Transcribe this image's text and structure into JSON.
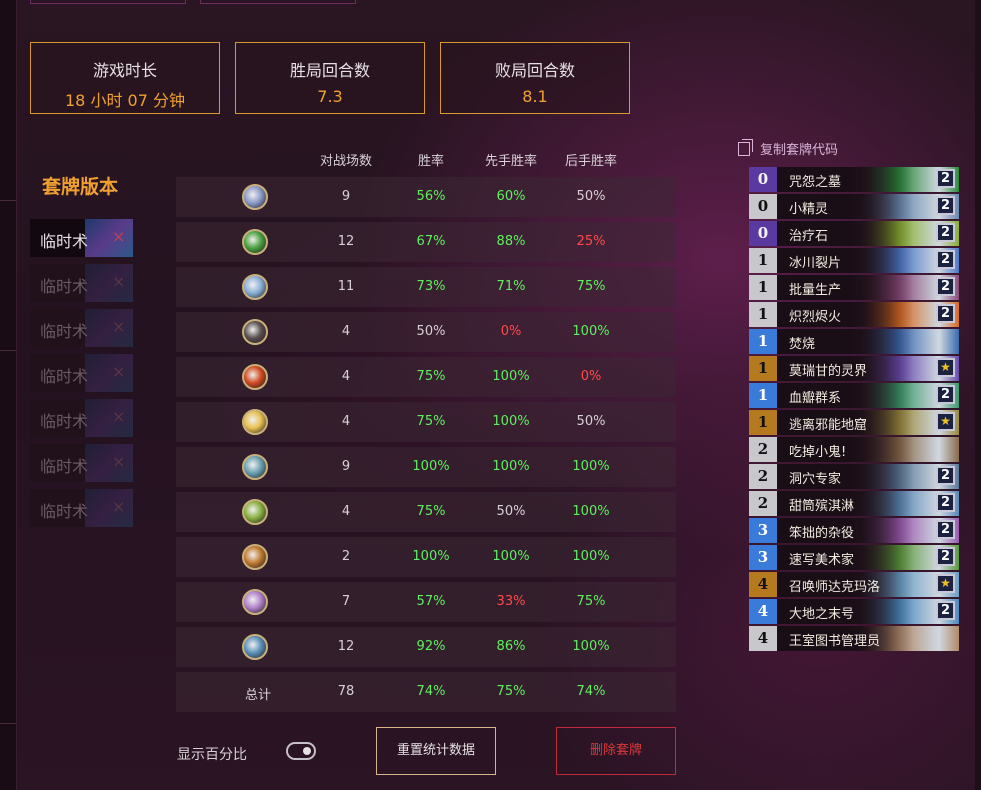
{
  "stats": [
    {
      "label": "游戏时长",
      "value": "18 小时 07 分钟"
    },
    {
      "label": "胜局回合数",
      "value": "7.3"
    },
    {
      "label": "败局回合数",
      "value": "8.1"
    }
  ],
  "deck_version": {
    "title": "套牌版本",
    "items": [
      {
        "name": "临时术",
        "state": "active"
      },
      {
        "name": "临时术",
        "state": "dim"
      },
      {
        "name": "临时术",
        "state": "dim"
      },
      {
        "name": "临时术",
        "state": "dim"
      },
      {
        "name": "临时术",
        "state": "dim"
      },
      {
        "name": "临时术",
        "state": "dim"
      },
      {
        "name": "临时术",
        "state": "dim"
      }
    ],
    "remove_glyph": "×"
  },
  "table": {
    "headers": [
      "对战场数",
      "胜率",
      "先手胜率",
      "后手胜率"
    ],
    "rows": [
      {
        "icon": "paladin-icon",
        "color": "#8a9ac8",
        "games": "9",
        "win": "56%",
        "first": "60%",
        "second": "50%"
      },
      {
        "icon": "druid-icon",
        "color": "#4aa040",
        "games": "12",
        "win": "67%",
        "first": "88%",
        "second": "25%"
      },
      {
        "icon": "mage-icon",
        "color": "#8ab0d8",
        "games": "11",
        "win": "73%",
        "first": "71%",
        "second": "75%"
      },
      {
        "icon": "rogue-icon",
        "color": "#5a5050",
        "games": "4",
        "win": "50%",
        "first": "0%",
        "second": "100%"
      },
      {
        "icon": "warrior-icon",
        "color": "#d04a20",
        "games": "4",
        "win": "75%",
        "first": "100%",
        "second": "0%"
      },
      {
        "icon": "priest-icon",
        "color": "#e8c050",
        "games": "4",
        "win": "75%",
        "first": "100%",
        "second": "50%"
      },
      {
        "icon": "shaman-icon",
        "color": "#6aa0b0",
        "games": "9",
        "win": "100%",
        "first": "100%",
        "second": "100%"
      },
      {
        "icon": "hunter-icon",
        "color": "#8ab040",
        "games": "4",
        "win": "75%",
        "first": "50%",
        "second": "100%"
      },
      {
        "icon": "warlock-icon",
        "color": "#c07a30",
        "games": "2",
        "win": "100%",
        "first": "100%",
        "second": "100%"
      },
      {
        "icon": "demon-hunter-icon",
        "color": "#b080c8",
        "games": "7",
        "win": "57%",
        "first": "33%",
        "second": "75%"
      },
      {
        "icon": "death-knight-icon",
        "color": "#5a90b8",
        "games": "12",
        "win": "92%",
        "first": "86%",
        "second": "100%"
      }
    ],
    "total": {
      "label": "总计",
      "games": "78",
      "win": "74%",
      "first": "75%",
      "second": "74%"
    }
  },
  "footer": {
    "toggle_label": "显示百分比",
    "toggle_on": true,
    "reset_label": "重置统计数据",
    "delete_label": "删除套牌"
  },
  "decklist": {
    "copy_label": "复制套牌代码",
    "cards": [
      {
        "cost": "0",
        "name": "咒怨之墓",
        "qty": "2",
        "cost_color": "c0",
        "art": "#2a8a3a"
      },
      {
        "cost": "0",
        "name": "小精灵",
        "qty": "2",
        "cost_color": "c1g",
        "art": "#6a8ab0"
      },
      {
        "cost": "0",
        "name": "治疗石",
        "qty": "2",
        "cost_color": "c0",
        "art": "#8ab030"
      },
      {
        "cost": "1",
        "name": "冰川裂片",
        "qty": "2",
        "cost_color": "c1g",
        "art": "#4a78c8"
      },
      {
        "cost": "1",
        "name": "批量生产",
        "qty": "2",
        "cost_color": "c1g",
        "art": "#8a4a7a"
      },
      {
        "cost": "1",
        "name": "炽烈烬火",
        "qty": "2",
        "cost_color": "c1g",
        "art": "#d86a20"
      },
      {
        "cost": "1",
        "name": "焚烧",
        "qty": "",
        "cost_color": "c1b",
        "art": "#3a6ab0"
      },
      {
        "cost": "1",
        "name": "莫瑞甘的灵界",
        "qty": "★",
        "cost_color": "c1o",
        "art": "#6a4ab0"
      },
      {
        "cost": "1",
        "name": "血瓣群系",
        "qty": "2",
        "cost_color": "c1b",
        "art": "#3a9a6a"
      },
      {
        "cost": "1",
        "name": "逃离邪能地窟",
        "qty": "★",
        "cost_color": "c1o",
        "art": "#9a8a3a"
      },
      {
        "cost": "2",
        "name": "吃掉小鬼!",
        "qty": "",
        "cost_color": "c1g",
        "art": "#8a6a4a"
      },
      {
        "cost": "2",
        "name": "洞穴专家",
        "qty": "2",
        "cost_color": "c1g",
        "art": "#5a7a9a"
      },
      {
        "cost": "2",
        "name": "甜筒殡淇淋",
        "qty": "2",
        "cost_color": "c1g",
        "art": "#5a8ab8"
      },
      {
        "cost": "3",
        "name": "笨拙的杂役",
        "qty": "2",
        "cost_color": "c1b",
        "art": "#9a5ab0"
      },
      {
        "cost": "3",
        "name": "速写美术家",
        "qty": "2",
        "cost_color": "c1b",
        "art": "#5a9a3a"
      },
      {
        "cost": "4",
        "name": "召唤师达克玛洛",
        "qty": "★",
        "cost_color": "c1o",
        "art": "#6aa0c8"
      },
      {
        "cost": "4",
        "name": "大地之末号",
        "qty": "2",
        "cost_color": "c1b",
        "art": "#4a8ac0"
      },
      {
        "cost": "4",
        "name": "王室图书管理员",
        "qty": "",
        "cost_color": "c1g",
        "art": "#b08a6a"
      }
    ]
  }
}
